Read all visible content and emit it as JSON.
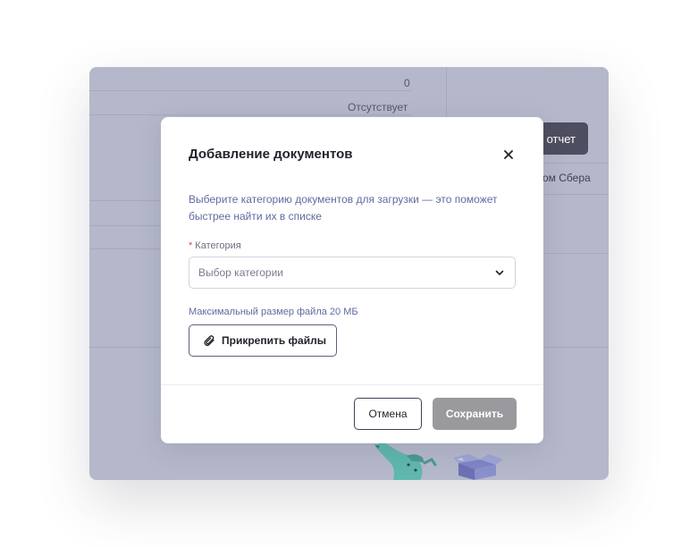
{
  "background": {
    "value_zero": "0",
    "status_absent": "Отсутствует",
    "report_button_partial": "отчет",
    "link_partial": "нтом Сбера"
  },
  "modal": {
    "title": "Добавление документов",
    "close_icon": "close-icon",
    "description": "Выберите категорию документов для загрузки — это поможет быстрее найти их в списке",
    "category": {
      "required_mark": "*",
      "label": "Категория",
      "placeholder": "Выбор категории",
      "chevron_icon": "chevron-down-icon"
    },
    "file_hint": "Максимальный размер файла 20 МБ",
    "attach_button": "Прикрепить файлы",
    "attach_icon": "paperclip-icon",
    "cancel_button": "Отмена",
    "save_button": "Сохранить"
  },
  "colors": {
    "overlay": "#b5b8cb",
    "save_disabled": "#9a9a9e",
    "description_text": "#626aa0",
    "required": "#e5484d"
  }
}
